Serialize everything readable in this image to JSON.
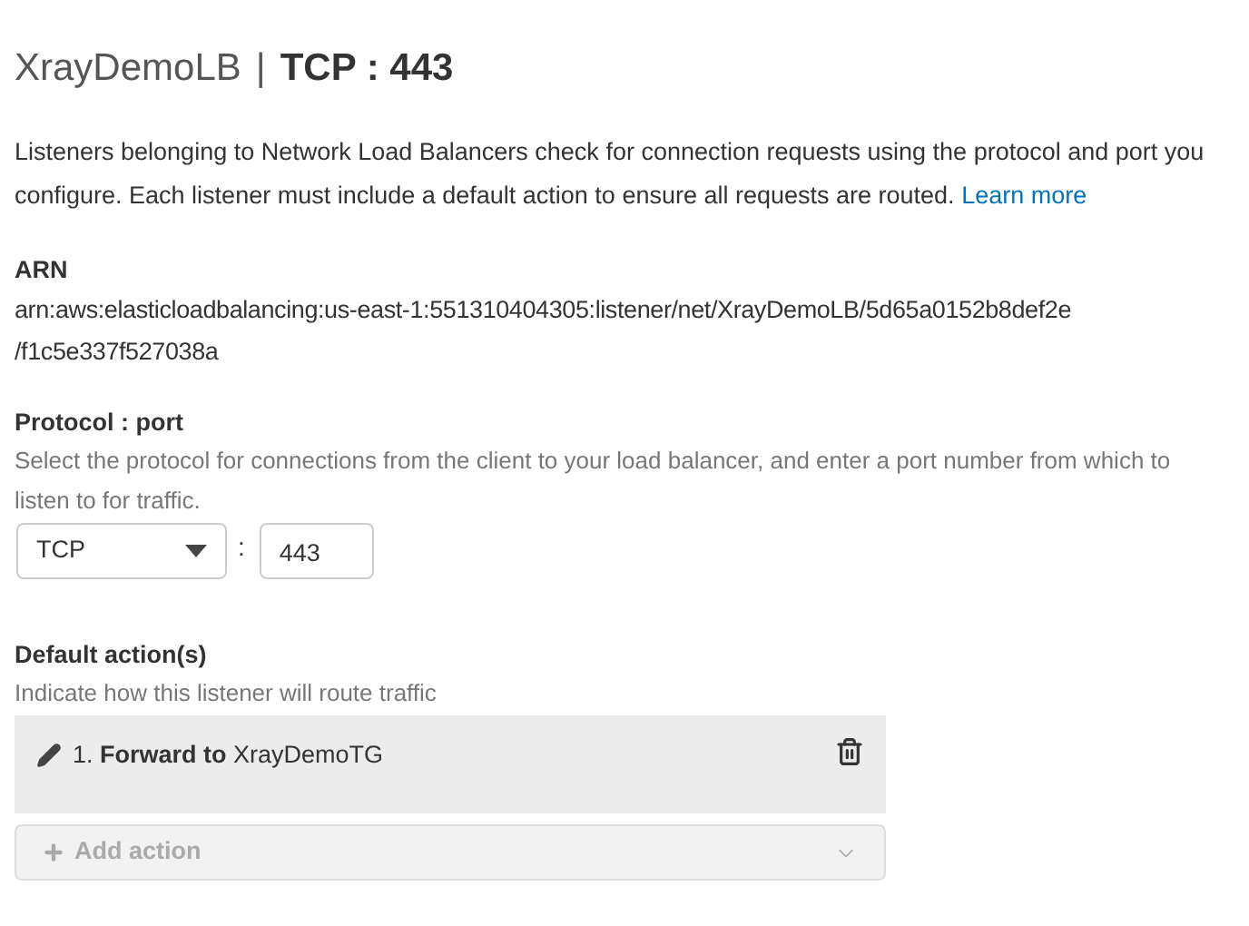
{
  "header": {
    "name": "XrayDemoLB",
    "separator": "|",
    "title": "TCP : 443"
  },
  "description": {
    "text": "Listeners belonging to Network Load Balancers check for connection requests using the protocol and port you configure. Each listener must include a default action to ensure all requests are routed.",
    "link": "Learn more"
  },
  "arn": {
    "label": "ARN",
    "value_lines": [
      "arn:aws:elasticloadbalancing:us-east-1:551310404305:listener/net/XrayDemoLB/5d65a0152b8def2e",
      "/f1c5e337f527038a"
    ]
  },
  "protocol_port": {
    "label": "Protocol : port",
    "help": "Select the protocol for connections from the client to your load balancer, and enter a port number from which to listen to for traffic.",
    "protocol": "TCP",
    "separator": ":",
    "port": "443"
  },
  "default_actions": {
    "label": "Default action(s)",
    "help": "Indicate how this listener will route traffic",
    "actions": [
      {
        "text": "1. **Forward to** XrayDemoTG"
      }
    ],
    "add_action": {
      "label": "Add action",
      "disabled": true
    }
  }
}
